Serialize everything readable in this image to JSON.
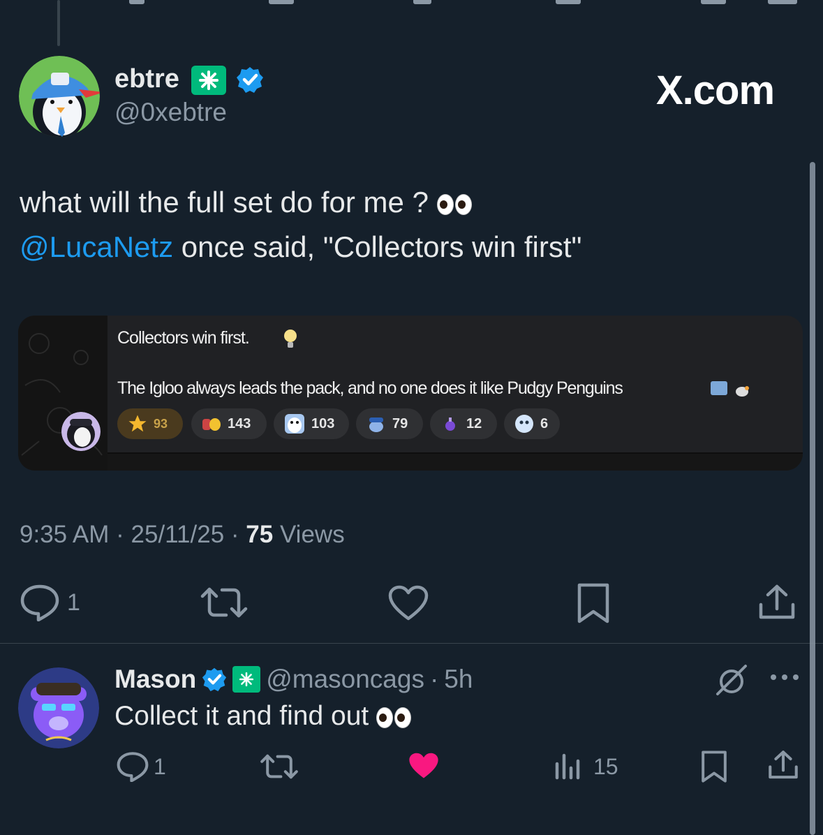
{
  "tweet": {
    "display_name": "ebtre",
    "handle": "@0xebtre",
    "watermark": "X.com",
    "text_line1": "what will the full set do for me ? ",
    "mention": "@LucaNetz",
    "text_line2": " once said, \"Collectors win first\"",
    "time": "9:35 AM",
    "date": "25/11/25",
    "views_count": "75",
    "views_label": "Views",
    "reply_count": "1"
  },
  "quote": {
    "line1": "Collectors win first.",
    "line2": "The Igloo always leads the pack, and no one does it like Pudgy Penguins",
    "reactions": [
      {
        "icon": "star-icon",
        "count": "93"
      },
      {
        "icon": "penguin-duo-icon",
        "count": "143"
      },
      {
        "icon": "penguin-face-icon",
        "count": "103"
      },
      {
        "icon": "penguin-cap-icon",
        "count": "79"
      },
      {
        "icon": "potion-icon",
        "count": "12"
      },
      {
        "icon": "ghost-penguin-icon",
        "count": "6"
      }
    ]
  },
  "reply": {
    "display_name": "Mason",
    "handle": "@masoncags",
    "age": "5h",
    "text": "Collect it and find out ",
    "reply_count": "1",
    "views_count": "15",
    "like_color": "#f91880"
  },
  "colors": {
    "background": "#15202b",
    "accent": "#1d9bf0",
    "muted": "#8b98a5",
    "verified_green": "#00ba7c"
  }
}
